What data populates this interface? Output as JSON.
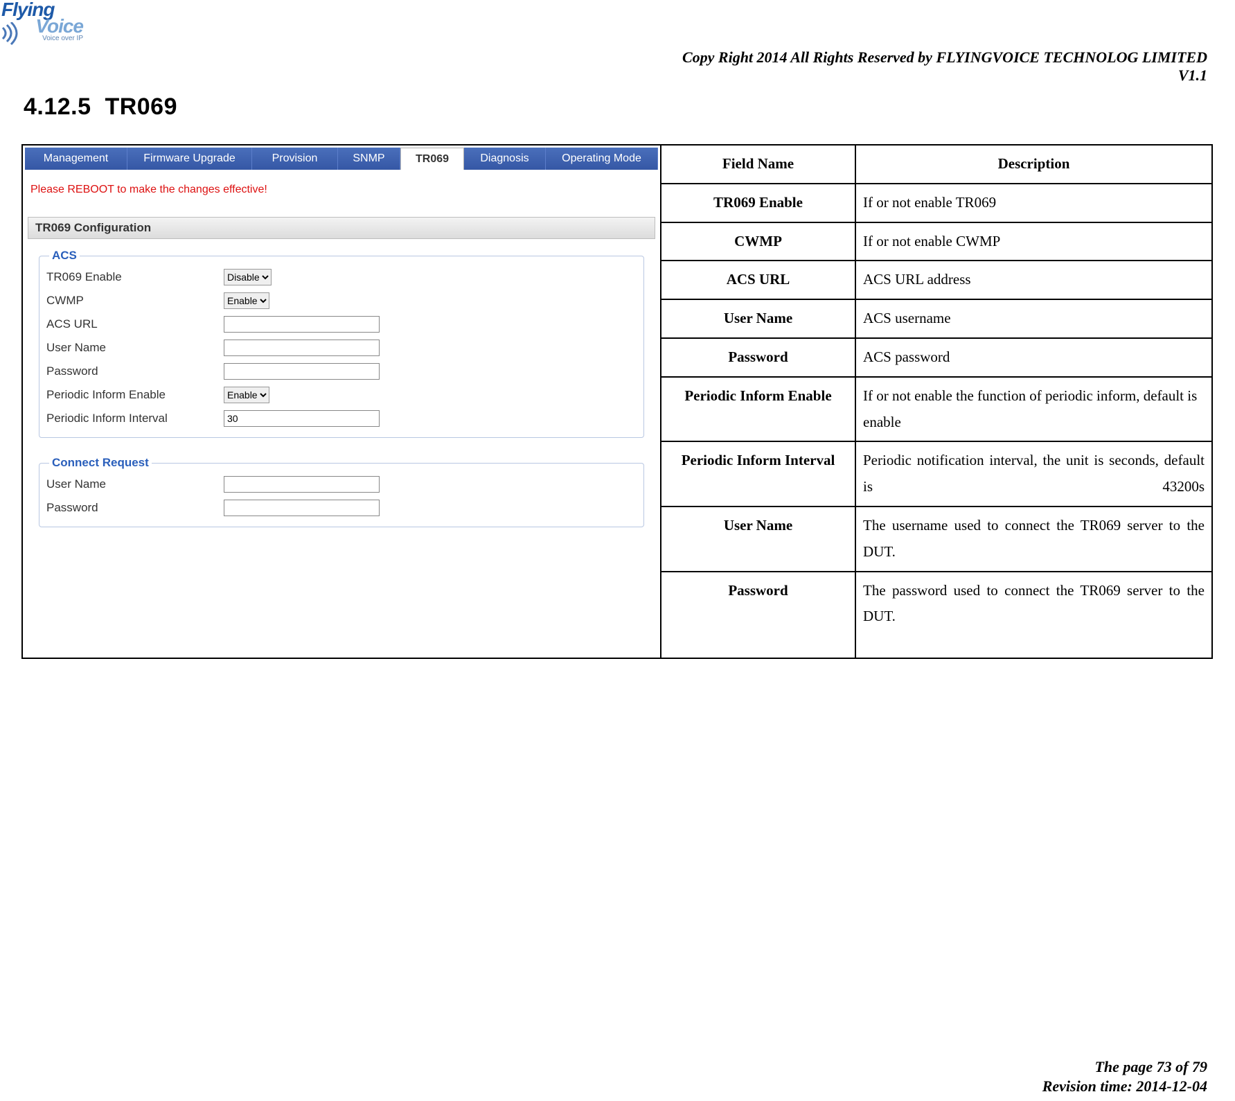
{
  "logo": {
    "line1": "Flying",
    "line2": "Voice",
    "tag": "Voice over IP"
  },
  "header": {
    "copyright": "Copy Right 2014 All Rights Reserved by FLYINGVOICE TECHNOLOG LIMITED",
    "version": "V1.1"
  },
  "section": {
    "number": "4.12.5",
    "title": "TR069"
  },
  "tabs": {
    "management": "Management",
    "firmware": "Firmware Upgrade",
    "provision": "Provision",
    "snmp": "SNMP",
    "tr069": "TR069",
    "diagnosis": "Diagnosis",
    "operating": "Operating Mode"
  },
  "notice": "Please REBOOT to make the changes effective!",
  "panels": {
    "config_title": "TR069 Configuration",
    "acs_legend": "ACS",
    "connreq_legend": "Connect Request"
  },
  "form": {
    "tr069_enable": {
      "label": "TR069 Enable",
      "value": "Disable"
    },
    "cwmp": {
      "label": "CWMP",
      "value": "Enable"
    },
    "acs_url": {
      "label": "ACS URL",
      "value": ""
    },
    "user_name": {
      "label": "User Name",
      "value": ""
    },
    "password": {
      "label": "Password",
      "value": ""
    },
    "periodic_enable": {
      "label": "Periodic Inform Enable",
      "value": "Enable"
    },
    "periodic_interval": {
      "label": "Periodic Inform Interval",
      "value": "30"
    },
    "cr_user": {
      "label": "User Name",
      "value": ""
    },
    "cr_pass": {
      "label": "Password",
      "value": ""
    }
  },
  "desc_table": {
    "header": {
      "field": "Field Name",
      "desc": "Description"
    },
    "rows": [
      {
        "field": "TR069 Enable",
        "desc": "If or not enable TR069"
      },
      {
        "field": "CWMP",
        "desc": "If or not enable CWMP"
      },
      {
        "field": "ACS URL",
        "desc": "ACS URL address"
      },
      {
        "field": "User Name",
        "desc": "ACS username"
      },
      {
        "field": "Password",
        "desc": "ACS password"
      },
      {
        "field": "Periodic Inform Enable",
        "desc": "If or not enable the function of periodic inform, default is enable"
      },
      {
        "field": "Periodic Inform Interval",
        "desc": "Periodic notification interval, the unit is seconds, default is 43200s"
      },
      {
        "field": "User Name",
        "desc": "The username used to connect the TR069 server to the DUT."
      },
      {
        "field": "Password",
        "desc": "The password used to connect the TR069 server to the DUT."
      }
    ]
  },
  "footer": {
    "page": "The page 73 of 79",
    "revision": "Revision time: 2014-12-04"
  }
}
